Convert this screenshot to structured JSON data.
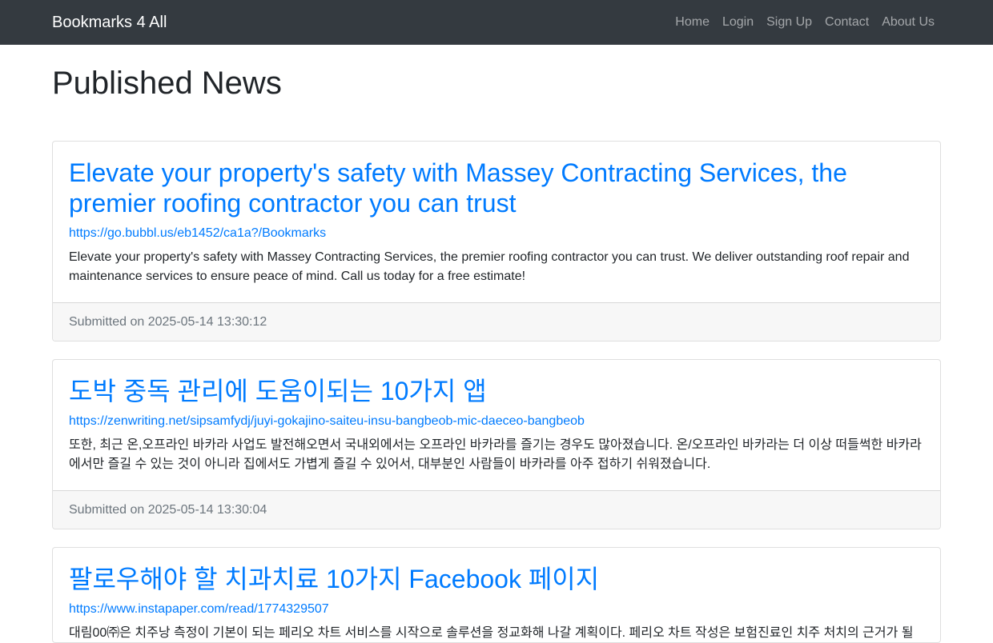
{
  "navbar": {
    "brand": "Bookmarks 4 All",
    "links": [
      "Home",
      "Login",
      "Sign Up",
      "Contact",
      "About Us"
    ]
  },
  "page": {
    "title": "Published News"
  },
  "cards": [
    {
      "title": "Elevate your property's safety with Massey Contracting Services, the premier roofing contractor you can trust",
      "url": "https://go.bubbl.us/eb1452/ca1a?/Bookmarks",
      "text": "Elevate your property's safety with Massey Contracting Services, the premier roofing contractor you can trust. We deliver outstanding roof repair and maintenance services to ensure peace of mind. Call us today for a free estimate!",
      "footer": "Submitted on 2025-05-14 13:30:12"
    },
    {
      "title": "도박 중독 관리에 도움이되는 10가지 앱",
      "url": "https://zenwriting.net/sipsamfydj/juyi-gokajino-saiteu-insu-bangbeob-mic-daeceo-bangbeob",
      "text": "또한, 최근 온,오프라인 바카라 사업도 발전해오면서 국내외에서는 오프라인 바카라를 즐기는 경우도 많아졌습니다. 온/오프라인 바카라는 더 이상 떠들썩한 바카라에서만 즐길 수 있는 것이 아니라 집에서도 가볍게 즐길 수 있어서, 대부분인 사람들이 바카라를 아주 접하기 쉬워졌습니다.",
      "footer": "Submitted on 2025-05-14 13:30:04"
    },
    {
      "title": "팔로우해야 할 치과치료 10가지 Facebook 페이지",
      "url": "https://www.instapaper.com/read/1774329507",
      "text": "대림00㈜은 치주낭 측정이 기본이 되는 페리오 차트 서비스를 시작으로 솔루션을 정교화해 나갈 계획이다. 페리오 차트 작성은 보험진료인 치주 처치의 근거가 될",
      "footer": ""
    }
  ]
}
